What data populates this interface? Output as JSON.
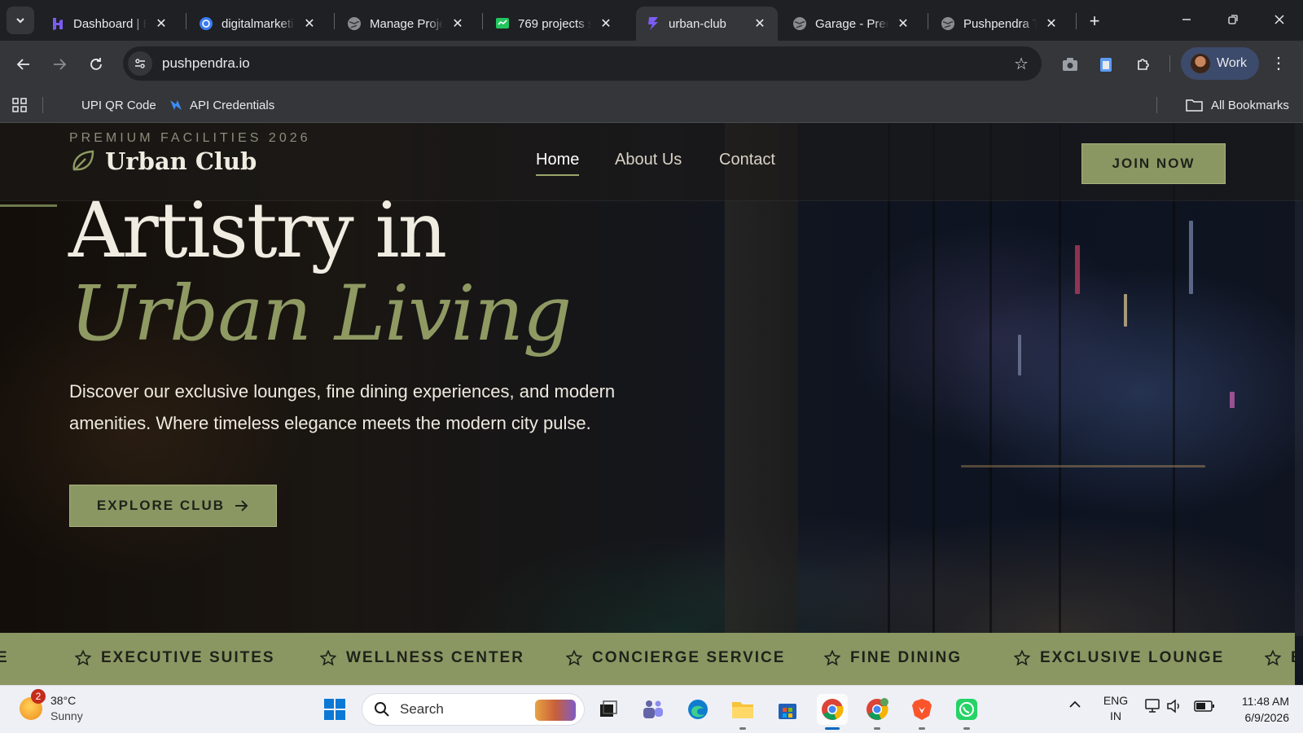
{
  "browser": {
    "tabs": [
      {
        "title": "Dashboard | H",
        "icon": "hostinger-icon",
        "active": false
      },
      {
        "title": "digitalmarketi",
        "icon": "globe-blue-icon",
        "active": false
      },
      {
        "title": "Manage Proje",
        "icon": "globe-icon",
        "active": false
      },
      {
        "title": "769 projects s",
        "icon": "sheet-icon",
        "active": false
      },
      {
        "title": "urban-club",
        "icon": "bolt-icon",
        "active": true
      },
      {
        "title": "Garage - Pren",
        "icon": "globe-icon",
        "active": false
      },
      {
        "title": "Pushpendra T",
        "icon": "globe-icon",
        "active": false
      }
    ],
    "url": "pushpendra.io",
    "profile_label": "Work",
    "bookmarks": [
      {
        "label": "UPI QR Code"
      },
      {
        "label": "API Credentials"
      }
    ],
    "all_bookmarks_label": "All Bookmarks"
  },
  "site": {
    "eyebrow": "PREMIUM FACILITIES 2026",
    "brand": "Urban Club",
    "nav": [
      {
        "label": "Home",
        "active": true
      },
      {
        "label": "About Us",
        "active": false
      },
      {
        "label": "Contact",
        "active": false
      }
    ],
    "join_label": "JOIN NOW",
    "headline_line1": "Artistry in",
    "headline_line2": "Urban Living",
    "lede": "Discover our exclusive lounges, fine dining experiences, and modern amenities. Where timeless elegance meets the modern city pulse.",
    "explore_label": "EXPLORE CLUB",
    "marquee": [
      "E",
      "EXECUTIVE SUITES",
      "WELLNESS CENTER",
      "CONCIERGE SERVICE",
      "FINE DINING",
      "EXCLUSIVE LOUNGE",
      "E"
    ],
    "colors": {
      "accent": "#8b9763",
      "accent_text": "#1e231a",
      "headline": "#f1ece2",
      "headline_italic": "#8f9a63"
    }
  },
  "taskbar": {
    "weather_temp": "38°C",
    "weather_desc": "Sunny",
    "weather_badge": "2",
    "search_placeholder": "Search",
    "lang_line1": "ENG",
    "lang_line2": "IN",
    "time": "11:48 AM",
    "date": "6/9/2026"
  }
}
